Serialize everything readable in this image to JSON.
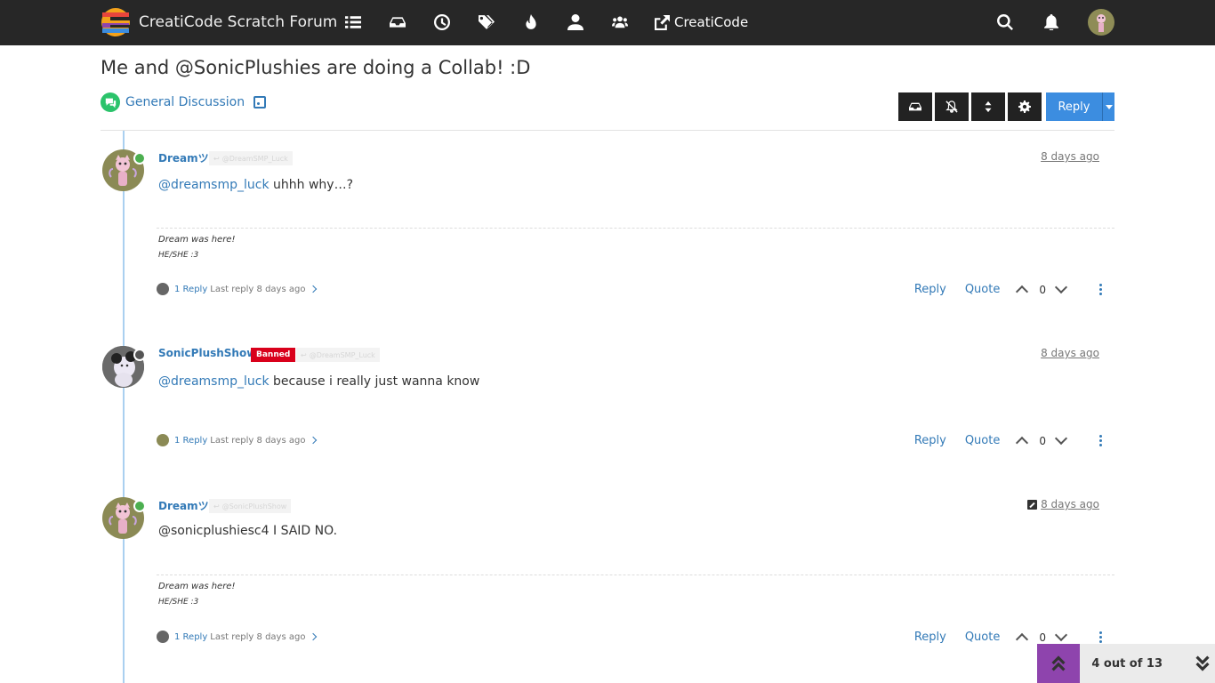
{
  "app": {
    "title": "CreatiCode Scratch Forum",
    "external_link": "CreatiCode"
  },
  "topic": {
    "title": "Me and @SonicPlushies are doing a Collab! :D",
    "category": "General Discussion",
    "reply_button": "Reply"
  },
  "colors": {
    "navbar": "#272727",
    "accent": "#337ab7",
    "category": "#2bc36b",
    "banned": "#d9001b",
    "pagination_up": "#8e44ad"
  },
  "icons": {
    "nav": [
      "categories-icon",
      "unread-icon",
      "recent-icon",
      "tags-icon",
      "popular-icon",
      "users-icon",
      "groups-icon"
    ],
    "toolbar": [
      "mark-unread-icon",
      "unwatch-icon",
      "sort-icon",
      "tools-gear-icon"
    ]
  },
  "posts": [
    {
      "author": "Dreamツ",
      "reply_to": "@DreamSMP_Luck",
      "timestamp": "8 days ago",
      "mention": "@dreamsmp_luck",
      "text": " uhhh why…?",
      "signature_line1": "Dream was here!",
      "signature_line2": "HE/SHE :3",
      "replies_count": "1 Reply",
      "last_reply": "Last reply 8 days ago",
      "action_reply": "Reply",
      "action_quote": "Quote",
      "votes": "0"
    },
    {
      "author": "SonicPlushShow",
      "badge": "Banned",
      "reply_to": "@DreamSMP_Luck",
      "timestamp": "8 days ago",
      "mention": "@dreamsmp_luck",
      "text": " because i really just wanna know",
      "replies_count": "1 Reply",
      "last_reply": "Last reply 8 days ago",
      "action_reply": "Reply",
      "action_quote": "Quote",
      "votes": "0"
    },
    {
      "author": "Dreamツ",
      "reply_to": "@SonicPlushShow",
      "timestamp": "8 days ago",
      "text": "@sonicplushiesc4 I SAID NO.",
      "signature_line1": "Dream was here!",
      "signature_line2": "HE/SHE :3",
      "replies_count": "1 Reply",
      "last_reply": "Last reply 8 days ago",
      "action_reply": "Reply",
      "action_quote": "Quote",
      "votes": "0"
    }
  ],
  "pagination": {
    "text": "4 out of 13"
  }
}
